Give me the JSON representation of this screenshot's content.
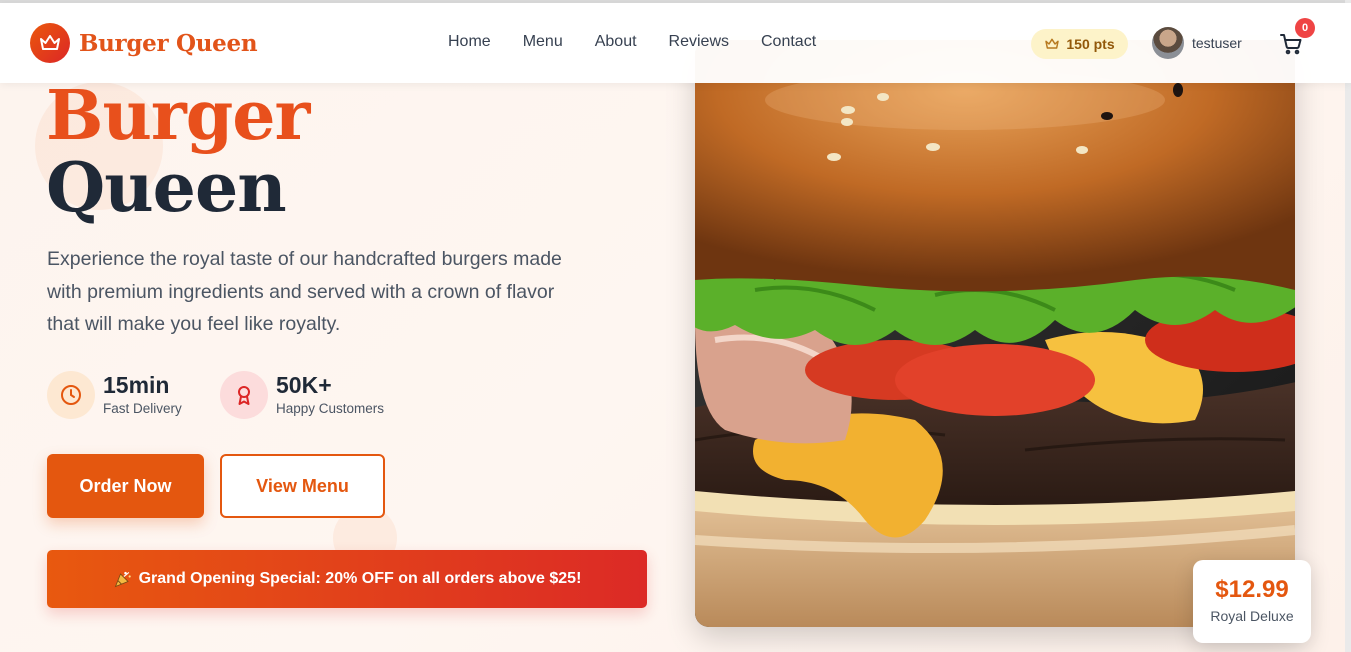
{
  "brand": {
    "name": "Burger Queen",
    "logo_icon": "crown-icon"
  },
  "nav": {
    "links": [
      "Home",
      "Menu",
      "About",
      "Reviews",
      "Contact"
    ]
  },
  "user": {
    "points": "150 pts",
    "username": "testuser",
    "cart_count": "0"
  },
  "hero": {
    "title_line1": "Burger",
    "title_line2": "Queen",
    "description": "Experience the royal taste of our handcrafted burgers made with premium ingredients and served with a crown of flavor that will make you feel like royalty.",
    "stats": [
      {
        "value": "15min",
        "label": "Fast Delivery",
        "icon": "clock-icon"
      },
      {
        "value": "50K+",
        "label": "Happy Customers",
        "icon": "award-icon"
      }
    ],
    "buttons": {
      "primary": "Order Now",
      "secondary": "View Menu"
    },
    "promo": "Grand Opening Special: 20% OFF on all orders above $25!"
  },
  "featured": {
    "price": "$12.99",
    "name": "Royal Deluxe"
  },
  "colors": {
    "accent": "#e4570f",
    "accent_red": "#dc2626",
    "dark": "#1f2937"
  }
}
